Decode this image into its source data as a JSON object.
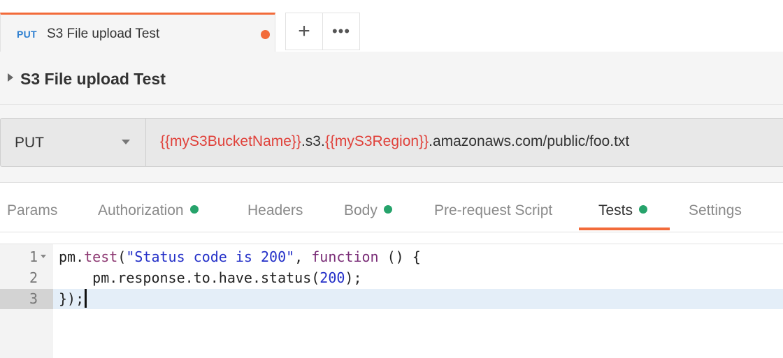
{
  "tab": {
    "method": "PUT",
    "name": "S3 File upload Test",
    "unsaved_dot_color": "#f26b3a",
    "new_tab_icon": "plus-icon",
    "more_icon": "more-horizontal-icon",
    "new_tab_label": "+",
    "more_label": "•••"
  },
  "request": {
    "title": "S3 File upload Test",
    "method": "PUT",
    "url_parts": [
      {
        "text": "{{myS3BucketName}}",
        "var": true
      },
      {
        "text": ".s3.",
        "var": false
      },
      {
        "text": "{{myS3Region}}",
        "var": true
      },
      {
        "text": ".amazonaws.com/public/foo.txt",
        "var": false
      }
    ]
  },
  "request_tabs": [
    {
      "label": "Params",
      "dot": false,
      "active": false
    },
    {
      "label": "Authorization",
      "dot": true,
      "active": false
    },
    {
      "label": "Headers",
      "dot": false,
      "active": false
    },
    {
      "label": "Body",
      "dot": true,
      "active": false
    },
    {
      "label": "Pre-request Script",
      "dot": false,
      "active": false
    },
    {
      "label": "Tests",
      "dot": true,
      "active": true
    },
    {
      "label": "Settings",
      "dot": false,
      "active": false
    }
  ],
  "editor": {
    "lines": [
      {
        "num": "1",
        "foldable": true
      },
      {
        "num": "2",
        "foldable": false
      },
      {
        "num": "3",
        "foldable": false
      }
    ],
    "line1": {
      "obj": "pm.",
      "fn": "test",
      "open": "(",
      "str": "\"Status code is 200\"",
      "comma": ", ",
      "kw": "function",
      "rest": " () {"
    },
    "line2": {
      "indent": "    ",
      "text": "pm.response.to.have.status(",
      "num": "200",
      "end": ");"
    },
    "line3": {
      "text": "});"
    }
  },
  "colors": {
    "accent": "#f26b3a",
    "method_blue": "#2d7fd0",
    "variable_red": "#e0413a",
    "status_green": "#26a36b"
  }
}
